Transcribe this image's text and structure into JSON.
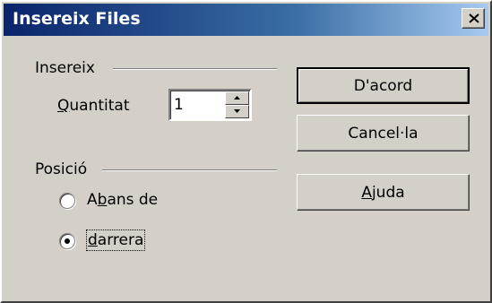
{
  "window": {
    "title": "Insereix Files"
  },
  "insert_group": {
    "label": "Insereix",
    "quantity_label_pre": "",
    "quantity_label_mnemonic": "Q",
    "quantity_label_post": "uantitat",
    "quantity_value": "1"
  },
  "position_group": {
    "label": "Posició",
    "options": [
      {
        "pre": "A",
        "mnemonic": "b",
        "post": "ans de",
        "checked": false
      },
      {
        "pre": "",
        "mnemonic": "d",
        "post": "arrera",
        "checked": true
      }
    ]
  },
  "buttons": {
    "ok": "D'acord",
    "cancel": "Cancel·la",
    "help_mnemonic": "A",
    "help_post": "juda"
  },
  "icons": {
    "close": "close-icon",
    "spin_up": "arrow-up-icon",
    "spin_down": "arrow-down-icon"
  }
}
